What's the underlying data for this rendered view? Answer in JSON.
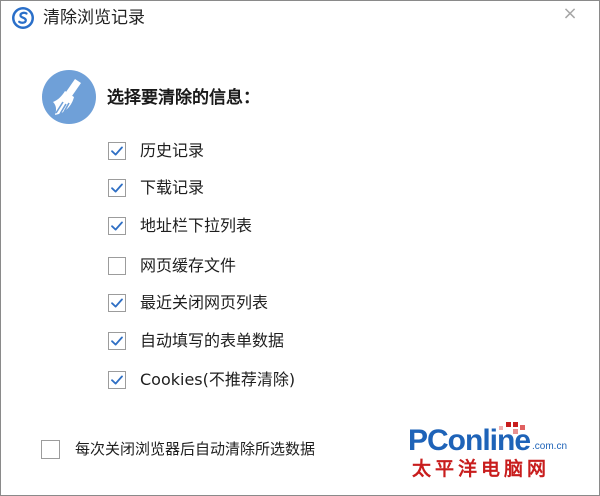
{
  "window": {
    "title": "清除浏览记录",
    "close_glyph": "×"
  },
  "icons": {
    "app": "browser-logo-icon",
    "broom": "broom-icon",
    "check": "checkmark-icon"
  },
  "colors": {
    "accent": "#1e63b8",
    "check": "#2f6fc4",
    "icon_bg": "#6fa0d8",
    "watermark_red": "#c81d1d"
  },
  "main": {
    "heading": "选择要清除的信息：",
    "options": [
      {
        "label": "历史记录",
        "checked": true
      },
      {
        "label": "下载记录",
        "checked": true
      },
      {
        "label": "地址栏下拉列表",
        "checked": true
      },
      {
        "label": "网页缓存文件",
        "checked": false
      },
      {
        "label": "最近关闭网页列表",
        "checked": true
      },
      {
        "label": "自动填写的表单数据",
        "checked": true
      },
      {
        "label": "Cookies(不推荐清除)",
        "checked": true
      }
    ]
  },
  "footer": {
    "auto_clear_label": "每次关闭浏览器后自动清除所选数据",
    "auto_clear_checked": false
  },
  "watermark": {
    "brand": "PConline",
    "domain": ".com.cn",
    "chinese": "太平洋电脑网"
  }
}
